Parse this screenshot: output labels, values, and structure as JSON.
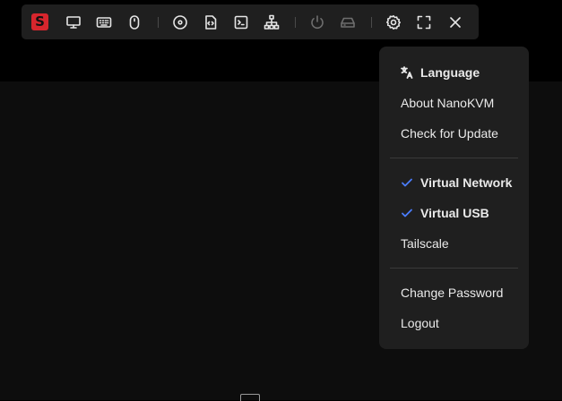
{
  "toolbar": {
    "logo_letter": "S",
    "accent_color": "#d7262d",
    "buttons": [
      "screen-icon",
      "keyboard-icon",
      "mouse-icon",
      "disk-icon",
      "script-icon",
      "terminal-icon",
      "network-icon",
      "power-icon",
      "storage-icon",
      "settings-icon",
      "fullscreen-icon",
      "close-icon"
    ]
  },
  "menu": {
    "items": [
      {
        "label": "Language",
        "icon": "translate-icon"
      },
      {
        "label": "About NanoKVM"
      },
      {
        "label": "Check for Update"
      },
      {
        "label": "Virtual Network",
        "checked": true
      },
      {
        "label": "Virtual USB",
        "checked": true
      },
      {
        "label": "Tailscale"
      },
      {
        "label": "Change Password"
      },
      {
        "label": "Logout"
      }
    ],
    "check_color": "#4a7dff"
  }
}
